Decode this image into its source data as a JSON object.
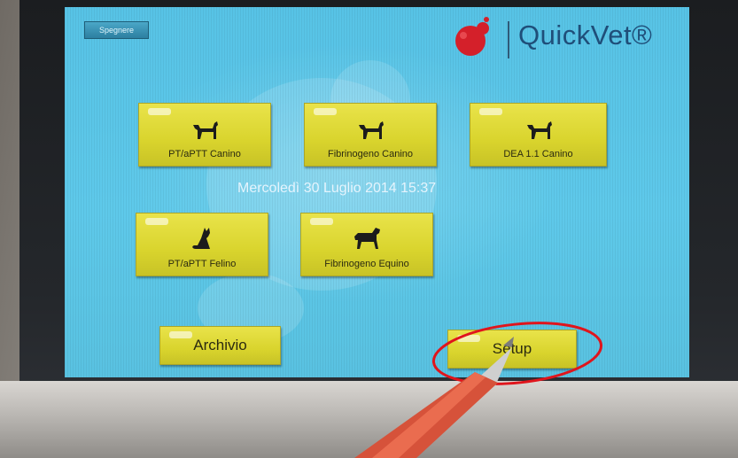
{
  "device": {
    "logo_name": "QuickVet®",
    "brand_color": "#1f4e79",
    "logo_mark_color": "#d4202a"
  },
  "topbar": {
    "power_off_label": "Spegnere"
  },
  "status": {
    "datetime": "Mercoledì 30 Luglio 2014 15:37"
  },
  "tests": [
    {
      "label": "PT/aPTT Canino",
      "icon": "dog-icon"
    },
    {
      "label": "Fibrinogeno Canino",
      "icon": "dog-icon"
    },
    {
      "label": "DEA 1.1 Canino",
      "icon": "dog-icon"
    },
    {
      "label": "PT/aPTT Felino",
      "icon": "cat-icon"
    },
    {
      "label": "Fibrinogeno Equino",
      "icon": "horse-icon"
    }
  ],
  "footer": {
    "archive_label": "Archivio",
    "setup_label": "Setup"
  },
  "colors": {
    "screen_bg": "#5ec9ea",
    "button_yellow": "#e2dc3c",
    "highlight_ring": "#e0151c"
  }
}
